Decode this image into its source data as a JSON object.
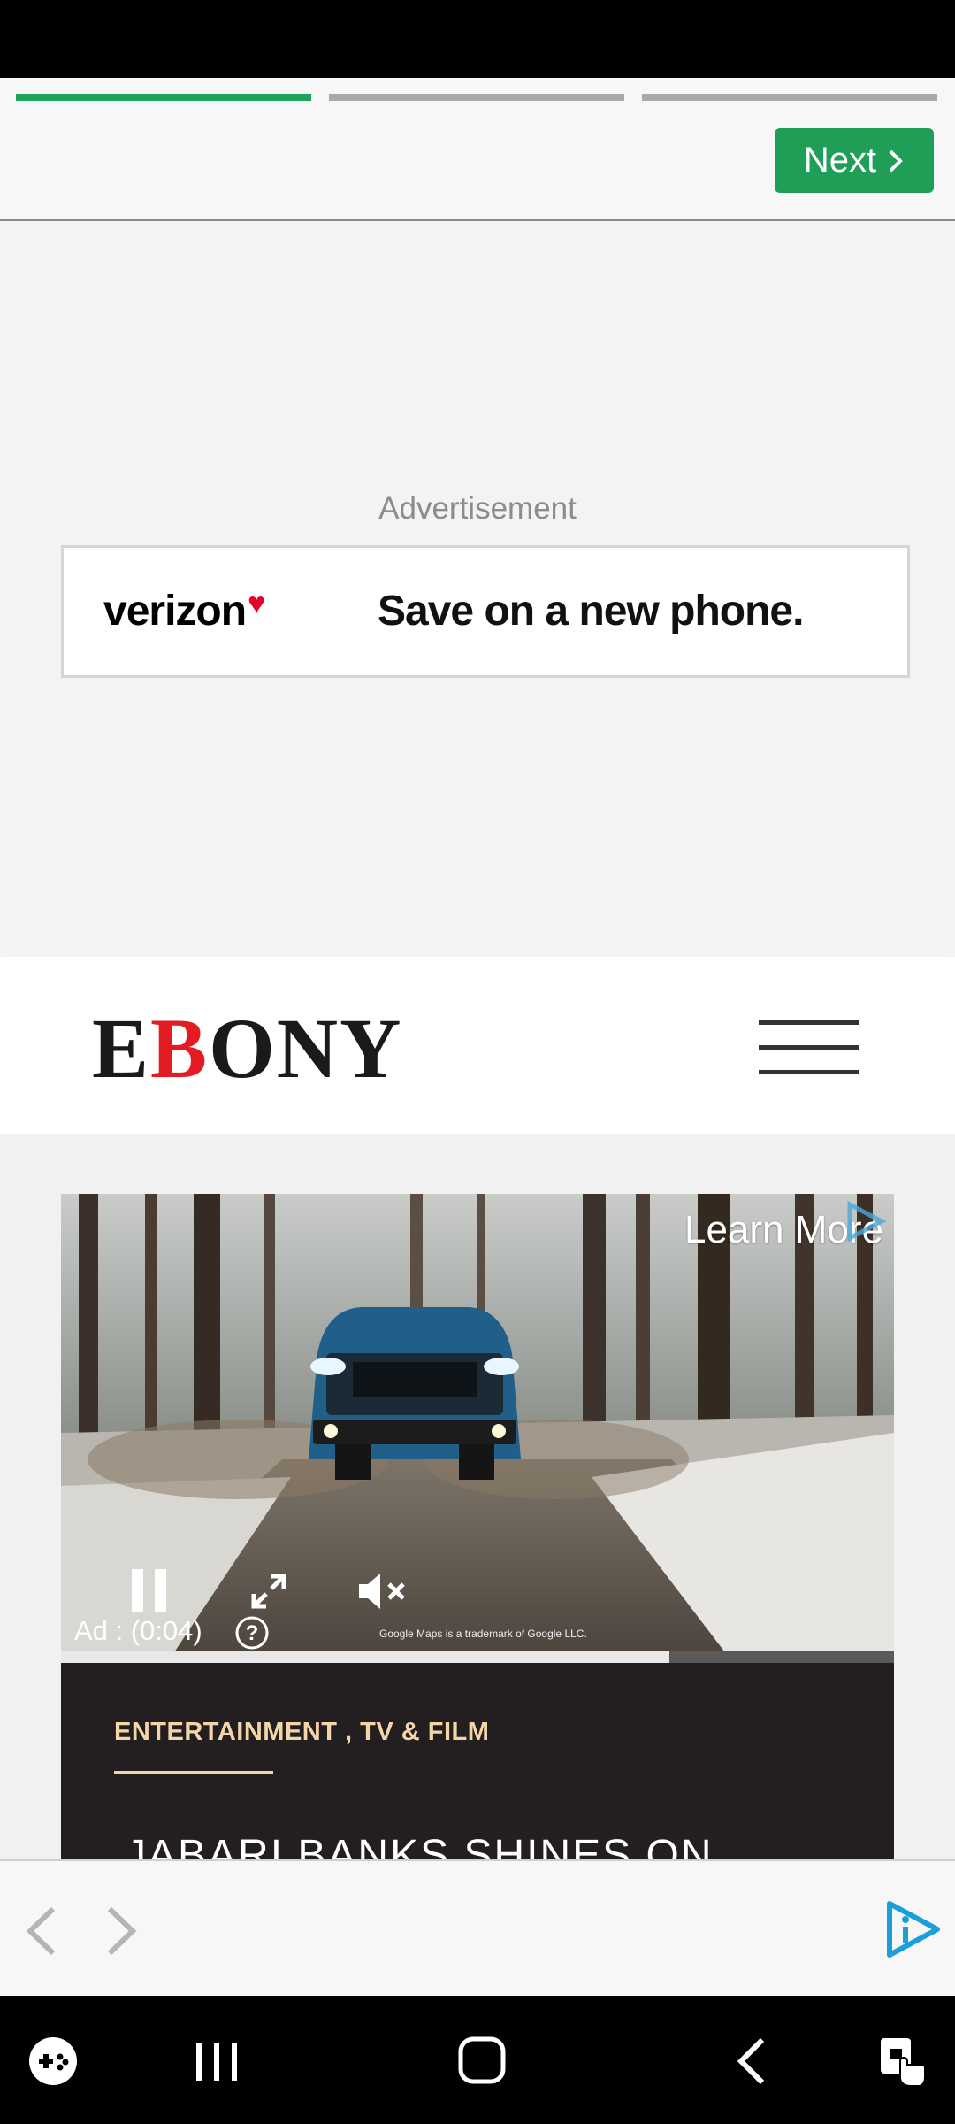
{
  "header": {
    "progress": [
      {
        "state": "active"
      },
      {
        "state": "inactive"
      },
      {
        "state": "inactive"
      }
    ],
    "next_label": "Next"
  },
  "ad": {
    "label": "Advertisement",
    "brand": "verizon",
    "tagline": "Save on a new phone.",
    "brand_accent_color": "#e4002b"
  },
  "site": {
    "logo_prefix": "E",
    "logo_highlight": "B",
    "logo_suffix": "ONY",
    "logo_highlight_color": "#e31b23"
  },
  "video": {
    "learn_more": "Learn More",
    "ad_timer": "Ad : (0:04)",
    "maps_note": "Google Maps is a trademark of Google LLC.",
    "progress_fraction": 0.73
  },
  "article": {
    "category": "ENTERTAINMENT , TV & FILM",
    "title": "JABARI BANKS SHINES ON"
  },
  "colors": {
    "accent_green": "#1f9e58",
    "article_bg": "#231f20",
    "category_color": "#f3d6a8",
    "brand_blue": "#1a9fd9"
  },
  "icons": {
    "toolbar_back": "chevron-left-icon",
    "toolbar_forward": "chevron-right-icon",
    "toolbar_brand": "play-info-icon",
    "nav": [
      "game-launcher-icon",
      "recent-apps-icon",
      "home-icon",
      "back-icon",
      "accessibility-icon"
    ]
  }
}
